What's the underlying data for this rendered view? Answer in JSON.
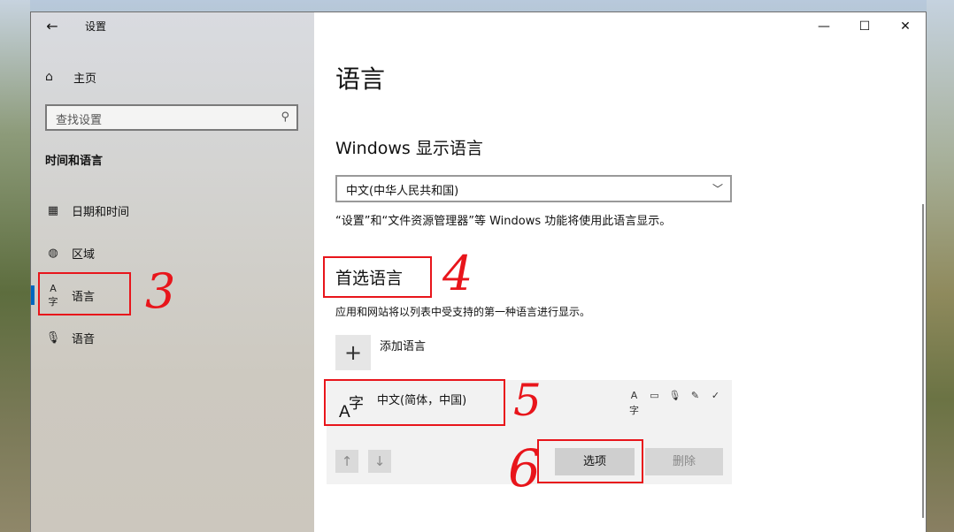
{
  "titlebar": {
    "back_icon": "back-arrow-icon",
    "title": "设置"
  },
  "window_controls": {
    "minimize": "—",
    "maximize": "☐",
    "close": "✕"
  },
  "sidebar": {
    "home_label": "主页",
    "search_placeholder": "查找设置",
    "section_heading": "时间和语言",
    "items": [
      {
        "label": "日期和时间",
        "icon": "calendar-clock-icon"
      },
      {
        "label": "区域",
        "icon": "globe-region-icon"
      },
      {
        "label": "语言",
        "icon": "language-icon",
        "selected": true
      },
      {
        "label": "语音",
        "icon": "microphone-icon"
      }
    ]
  },
  "main": {
    "page_title": "语言",
    "display_language": {
      "heading": "Windows 显示语言",
      "selected": "中文(中华人民共和国)",
      "description": "“设置”和“文件资源管理器”等 Windows 功能将使用此语言显示。"
    },
    "preferred": {
      "heading": "首选语言",
      "description": "应用和网站将以列表中受支持的第一种语言进行显示。",
      "add_label": "添加语言",
      "language": {
        "glyph_a": "A",
        "glyph_zi": "字",
        "name": "中文(简体，中国)",
        "options_label": "选项",
        "remove_label": "删除"
      }
    }
  },
  "annotations": [
    "3",
    "4",
    "5",
    "6"
  ],
  "colors": {
    "accent": "#0067c0",
    "annotation_red": "#e8151b"
  }
}
